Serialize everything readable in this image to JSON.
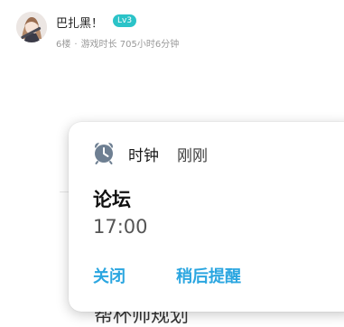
{
  "post": {
    "username": "巴扎黑！",
    "level": "Lv3",
    "floor": "6楼",
    "meta_separator": "·",
    "play_time": "游戏时长 705小时6分钟"
  },
  "underlying_content": {
    "text_fragment": "帮杯帅规划"
  },
  "notification": {
    "app_name": "时钟",
    "time_label": "刚刚",
    "icon": "alarm-clock-icon",
    "title": "论坛",
    "body": "17:00",
    "actions": {
      "dismiss": "关闭",
      "snooze": "稍后提醒"
    }
  },
  "colors": {
    "accent": "#2BA6E0",
    "level_badge": "#2BC3C8",
    "clock_icon": "#6E7F92"
  }
}
